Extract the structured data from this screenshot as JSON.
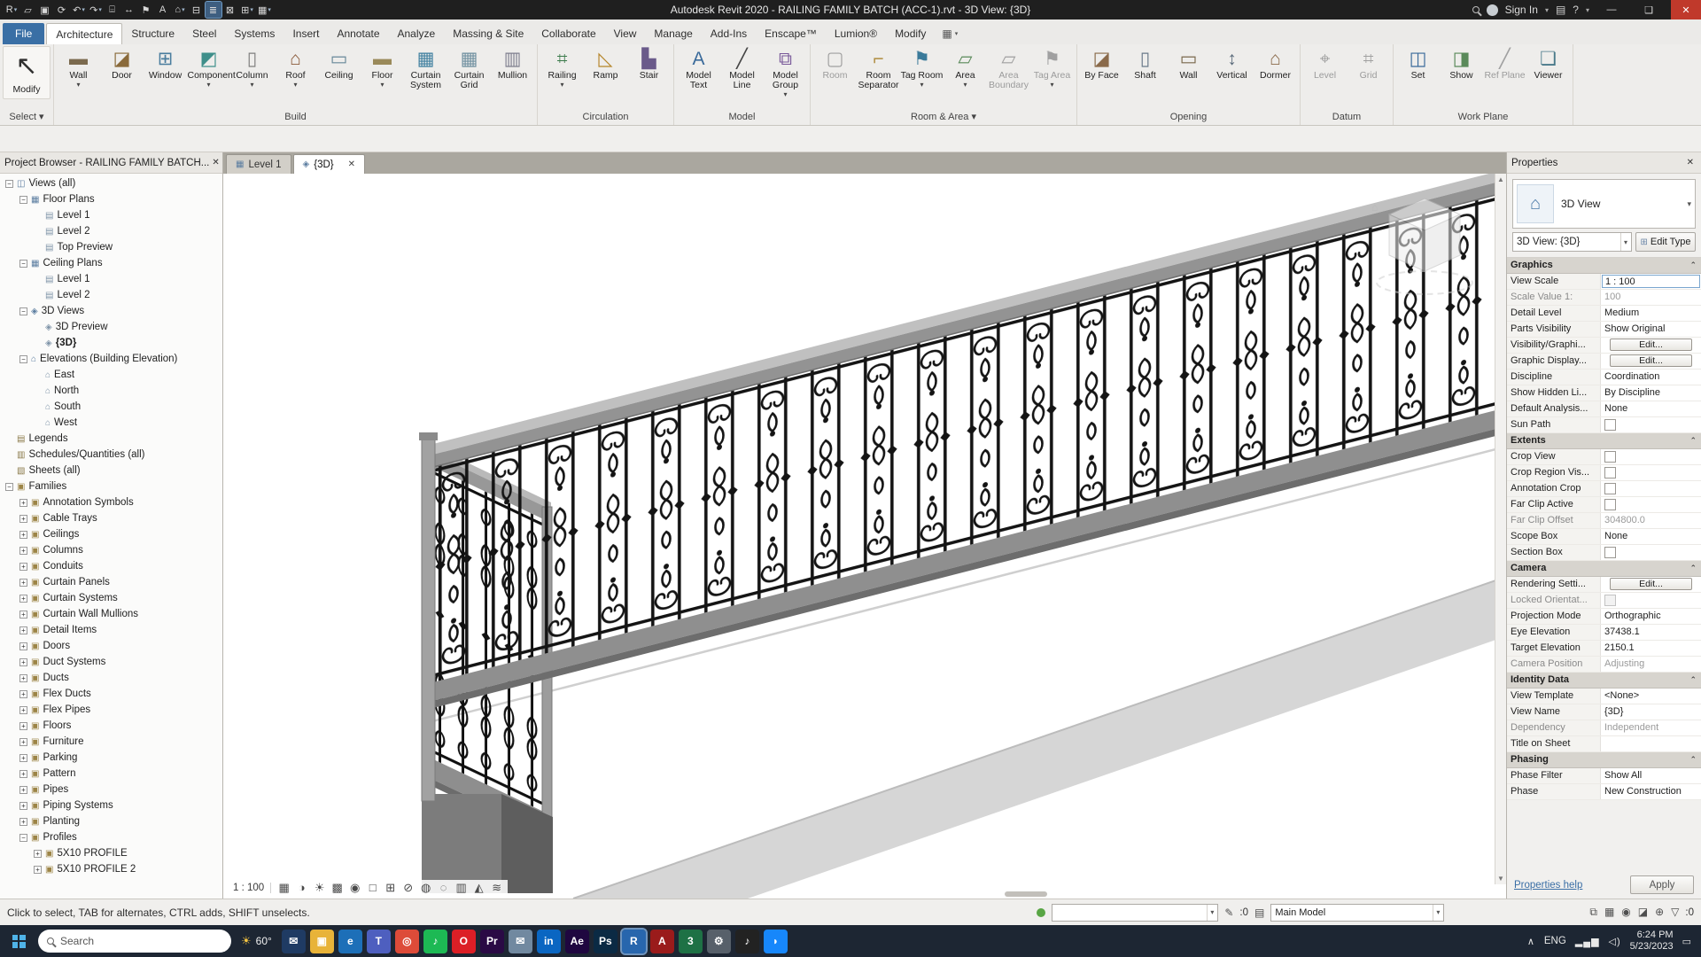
{
  "titlebar": {
    "title": "Autodesk Revit 2020 - RAILING FAMILY BATCH (ACC-1).rvt - 3D View: {3D}",
    "sign_in": "Sign In",
    "qat": [
      {
        "n": "app-menu",
        "g": "R",
        "arrow": "▾"
      },
      {
        "n": "open",
        "g": "▱"
      },
      {
        "n": "save",
        "g": "▣"
      },
      {
        "n": "sync",
        "g": "⟳"
      },
      {
        "n": "undo",
        "g": "↶",
        "arrow": "▾"
      },
      {
        "n": "redo",
        "g": "↷",
        "arrow": "▾"
      },
      {
        "n": "print",
        "g": "⌸"
      },
      {
        "n": "measure",
        "g": "↔"
      },
      {
        "n": "tag",
        "g": "⚑"
      },
      {
        "n": "text",
        "g": "A"
      },
      {
        "n": "default-3d-view",
        "g": "⌂",
        "arrow": "▾"
      },
      {
        "n": "section",
        "g": "⊟"
      },
      {
        "n": "thin-lines",
        "g": "≣",
        "active": true
      },
      {
        "n": "close-hidden-windows",
        "g": "⊠"
      },
      {
        "n": "switch-windows",
        "g": "⊞",
        "arrow": "▾"
      },
      {
        "n": "user-interface",
        "g": "▦",
        "arrow": "▾"
      }
    ]
  },
  "ribbon": {
    "tabs": [
      {
        "label": "File",
        "kind": "file"
      },
      {
        "label": "Architecture",
        "active": true
      },
      {
        "label": "Structure"
      },
      {
        "label": "Steel"
      },
      {
        "label": "Systems"
      },
      {
        "label": "Insert"
      },
      {
        "label": "Annotate"
      },
      {
        "label": "Analyze"
      },
      {
        "label": "Massing & Site"
      },
      {
        "label": "Collaborate"
      },
      {
        "label": "View"
      },
      {
        "label": "Manage"
      },
      {
        "label": "Add-Ins"
      },
      {
        "label": "Enscape™"
      },
      {
        "label": "Lumion®"
      },
      {
        "label": "Modify"
      }
    ],
    "panels": {
      "select": {
        "title": "Select ▾",
        "modify_label": "Modify",
        "modify_glyph": "↖"
      },
      "build": {
        "title": "Build",
        "buttons": [
          {
            "label": "Wall",
            "g": "▬",
            "c": "#7b6a4e",
            "arrow": "▾"
          },
          {
            "label": "Door",
            "g": "◪",
            "c": "#8a6a3a"
          },
          {
            "label": "Window",
            "g": "⊞",
            "c": "#4a7d9e"
          },
          {
            "label": "Component",
            "g": "◩",
            "c": "#3f8f8a",
            "arrow": "▾"
          },
          {
            "label": "Column",
            "g": "▯",
            "c": "#7f7f7f",
            "arrow": "▾"
          },
          {
            "label": "Roof",
            "g": "⌂",
            "c": "#8a5a3a",
            "arrow": "▾"
          },
          {
            "label": "Ceiling",
            "g": "▭",
            "c": "#6a8a9a"
          },
          {
            "label": "Floor",
            "g": "▬",
            "c": "#9a8a5a",
            "arrow": "▾"
          },
          {
            "label": "Curtain System",
            "g": "▦",
            "c": "#3f7f9f"
          },
          {
            "label": "Curtain Grid",
            "g": "▦",
            "c": "#6f8f9f"
          },
          {
            "label": "Mullion",
            "g": "▥",
            "c": "#7f7f8f"
          }
        ]
      },
      "circulation": {
        "title": "Circulation",
        "buttons": [
          {
            "label": "Railing",
            "g": "⌗",
            "c": "#3a7a4a",
            "arrow": "▾"
          },
          {
            "label": "Ramp",
            "g": "◺",
            "c": "#b5862b"
          },
          {
            "label": "Stair",
            "g": "▙",
            "c": "#6a5a8a"
          }
        ]
      },
      "model": {
        "title": "Model",
        "buttons": [
          {
            "label": "Model Text",
            "g": "A",
            "c": "#3a6a9a"
          },
          {
            "label": "Model Line",
            "g": "╱",
            "c": "#444444"
          },
          {
            "label": "Model Group",
            "g": "⧉",
            "c": "#7a5a9a",
            "arrow": "▾"
          }
        ]
      },
      "room_area": {
        "title": "Room & Area ▾",
        "buttons": [
          {
            "label": "Room",
            "g": "▢",
            "c": "#a0a0a0",
            "dis": true
          },
          {
            "label": "Room Separator",
            "g": "⌐",
            "c": "#b08d3f"
          },
          {
            "label": "Tag Room",
            "g": "⚑",
            "c": "#3a7a9a",
            "arrow": "▾"
          },
          {
            "label": "Area",
            "g": "▱",
            "c": "#5a8a5a",
            "arrow": "▾"
          },
          {
            "label": "Area Boundary",
            "g": "▱",
            "c": "#a0a0a0",
            "dis": true
          },
          {
            "label": "Tag Area",
            "g": "⚑",
            "c": "#a0a0a0",
            "arrow": "▾",
            "dis": true
          }
        ]
      },
      "opening": {
        "title": "Opening",
        "buttons": [
          {
            "label": "By Face",
            "g": "◪",
            "c": "#8a6a4a"
          },
          {
            "label": "Shaft",
            "g": "▯",
            "c": "#6a7a8a"
          },
          {
            "label": "Wall",
            "g": "▭",
            "c": "#7b6a4e"
          },
          {
            "label": "Vertical",
            "g": "↕",
            "c": "#5a6a7a"
          },
          {
            "label": "Dormer",
            "g": "⌂",
            "c": "#8a6a4a"
          }
        ]
      },
      "datum": {
        "title": "Datum",
        "buttons": [
          {
            "label": "Level",
            "g": "⌖",
            "c": "#a0a0a0",
            "dis": true
          },
          {
            "label": "Grid",
            "g": "⌗",
            "c": "#a0a0a0",
            "dis": true
          }
        ]
      },
      "work_plane": {
        "title": "Work Plane",
        "buttons": [
          {
            "label": "Set",
            "g": "◫",
            "c": "#3a6a9a"
          },
          {
            "label": "Show",
            "g": "◨",
            "c": "#5a8a5a"
          },
          {
            "label": "Ref Plane",
            "g": "╱",
            "c": "#a0a0a0",
            "dis": true
          },
          {
            "label": "Viewer",
            "g": "❏",
            "c": "#4a7a8a"
          }
        ]
      }
    }
  },
  "browser": {
    "header": "Project Browser - RAILING FAMILY BATCH...",
    "items": [
      {
        "lvl": 0,
        "exp": "−",
        "ic": "◫",
        "icc": "#5b7da0",
        "label": "Views (all)"
      },
      {
        "lvl": 1,
        "exp": "−",
        "ic": "▦",
        "icc": "#5b7da0",
        "label": "Floor Plans"
      },
      {
        "lvl": 2,
        "ic": "▤",
        "icc": "#7f94a8",
        "label": "Level 1"
      },
      {
        "lvl": 2,
        "ic": "▤",
        "icc": "#7f94a8",
        "label": "Level 2"
      },
      {
        "lvl": 2,
        "ic": "▤",
        "icc": "#7f94a8",
        "label": "Top Preview"
      },
      {
        "lvl": 1,
        "exp": "−",
        "ic": "▦",
        "icc": "#5b7da0",
        "label": "Ceiling Plans"
      },
      {
        "lvl": 2,
        "ic": "▤",
        "icc": "#7f94a8",
        "label": "Level 1"
      },
      {
        "lvl": 2,
        "ic": "▤",
        "icc": "#7f94a8",
        "label": "Level 2"
      },
      {
        "lvl": 1,
        "exp": "−",
        "ic": "◈",
        "icc": "#5b7da0",
        "label": "3D Views"
      },
      {
        "lvl": 2,
        "ic": "◈",
        "icc": "#7f94a8",
        "label": "3D Preview"
      },
      {
        "lvl": 2,
        "ic": "◈",
        "icc": "#7f94a8",
        "label": "{3D}",
        "sel": true
      },
      {
        "lvl": 1,
        "exp": "−",
        "ic": "⌂",
        "icc": "#5b7da0",
        "label": "Elevations (Building Elevation)"
      },
      {
        "lvl": 2,
        "ic": "⌂",
        "icc": "#7f94a8",
        "label": "East"
      },
      {
        "lvl": 2,
        "ic": "⌂",
        "icc": "#7f94a8",
        "label": "North"
      },
      {
        "lvl": 2,
        "ic": "⌂",
        "icc": "#7f94a8",
        "label": "South"
      },
      {
        "lvl": 2,
        "ic": "⌂",
        "icc": "#7f94a8",
        "label": "West"
      },
      {
        "lvl": 0,
        "ic": "▤",
        "icc": "#8a7a4a",
        "label": "Legends"
      },
      {
        "lvl": 0,
        "ic": "▥",
        "icc": "#8a7a4a",
        "label": "Schedules/Quantities (all)"
      },
      {
        "lvl": 0,
        "ic": "▧",
        "icc": "#8a7a4a",
        "label": "Sheets (all)"
      },
      {
        "lvl": 0,
        "exp": "−",
        "ic": "▣",
        "icc": "#9c8446",
        "label": "Families"
      },
      {
        "lvl": 1,
        "exp": "+",
        "ic": "▣",
        "icc": "#9c8446",
        "label": "Annotation Symbols"
      },
      {
        "lvl": 1,
        "exp": "+",
        "ic": "▣",
        "icc": "#9c8446",
        "label": "Cable Trays"
      },
      {
        "lvl": 1,
        "exp": "+",
        "ic": "▣",
        "icc": "#9c8446",
        "label": "Ceilings"
      },
      {
        "lvl": 1,
        "exp": "+",
        "ic": "▣",
        "icc": "#9c8446",
        "label": "Columns"
      },
      {
        "lvl": 1,
        "exp": "+",
        "ic": "▣",
        "icc": "#9c8446",
        "label": "Conduits"
      },
      {
        "lvl": 1,
        "exp": "+",
        "ic": "▣",
        "icc": "#9c8446",
        "label": "Curtain Panels"
      },
      {
        "lvl": 1,
        "exp": "+",
        "ic": "▣",
        "icc": "#9c8446",
        "label": "Curtain Systems"
      },
      {
        "lvl": 1,
        "exp": "+",
        "ic": "▣",
        "icc": "#9c8446",
        "label": "Curtain Wall Mullions"
      },
      {
        "lvl": 1,
        "exp": "+",
        "ic": "▣",
        "icc": "#9c8446",
        "label": "Detail Items"
      },
      {
        "lvl": 1,
        "exp": "+",
        "ic": "▣",
        "icc": "#9c8446",
        "label": "Doors"
      },
      {
        "lvl": 1,
        "exp": "+",
        "ic": "▣",
        "icc": "#9c8446",
        "label": "Duct Systems"
      },
      {
        "lvl": 1,
        "exp": "+",
        "ic": "▣",
        "icc": "#9c8446",
        "label": "Ducts"
      },
      {
        "lvl": 1,
        "exp": "+",
        "ic": "▣",
        "icc": "#9c8446",
        "label": "Flex Ducts"
      },
      {
        "lvl": 1,
        "exp": "+",
        "ic": "▣",
        "icc": "#9c8446",
        "label": "Flex Pipes"
      },
      {
        "lvl": 1,
        "exp": "+",
        "ic": "▣",
        "icc": "#9c8446",
        "label": "Floors"
      },
      {
        "lvl": 1,
        "exp": "+",
        "ic": "▣",
        "icc": "#9c8446",
        "label": "Furniture"
      },
      {
        "lvl": 1,
        "exp": "+",
        "ic": "▣",
        "icc": "#9c8446",
        "label": "Parking"
      },
      {
        "lvl": 1,
        "exp": "+",
        "ic": "▣",
        "icc": "#9c8446",
        "label": "Pattern"
      },
      {
        "lvl": 1,
        "exp": "+",
        "ic": "▣",
        "icc": "#9c8446",
        "label": "Pipes"
      },
      {
        "lvl": 1,
        "exp": "+",
        "ic": "▣",
        "icc": "#9c8446",
        "label": "Piping Systems"
      },
      {
        "lvl": 1,
        "exp": "+",
        "ic": "▣",
        "icc": "#9c8446",
        "label": "Planting"
      },
      {
        "lvl": 1,
        "exp": "−",
        "ic": "▣",
        "icc": "#9c8446",
        "label": "Profiles"
      },
      {
        "lvl": 2,
        "exp": "+",
        "ic": "▣",
        "icc": "#9c8446",
        "label": "5X10 PROFILE"
      },
      {
        "lvl": 2,
        "exp": "+",
        "ic": "▣",
        "icc": "#9c8446",
        "label": "5X10 PROFILE 2"
      }
    ]
  },
  "view_tabs": [
    {
      "label": "Level 1",
      "ic": "▦"
    },
    {
      "label": "{3D}",
      "ic": "◈",
      "active": true,
      "close": "✕"
    }
  ],
  "viewbar": {
    "scale": "1 : 100",
    "icons": [
      {
        "n": "detail-level",
        "g": "▦"
      },
      {
        "n": "visual-style",
        "g": "◑"
      },
      {
        "n": "sun-path",
        "g": "☀"
      },
      {
        "n": "shadows",
        "g": "▩"
      },
      {
        "n": "render-dialog",
        "g": "◉"
      },
      {
        "n": "crop-view",
        "g": "□"
      },
      {
        "n": "show-crop-region",
        "g": "⊞"
      },
      {
        "n": "unlocked-view",
        "g": "⊘"
      },
      {
        "n": "temporary-hide-isolate",
        "g": "◍"
      },
      {
        "n": "reveal-hidden-elements",
        "g": "◌"
      },
      {
        "n": "temporary-view-properties",
        "g": "▥"
      },
      {
        "n": "displace-elements",
        "g": "◭"
      },
      {
        "n": "selection-visibility",
        "g": "≋"
      }
    ]
  },
  "properties": {
    "header": "Properties",
    "type_selector": {
      "label": "3D View",
      "icon_glyph": "⌂"
    },
    "view_combo": "3D View: {3D}",
    "edit_type": "Edit Type",
    "rows": [
      {
        "k": "section",
        "label": "Graphics"
      },
      {
        "k": "input",
        "label": "View Scale",
        "value": "1 : 100"
      },
      {
        "k": "text",
        "label": "Scale Value    1:",
        "value": "100",
        "dim": true
      },
      {
        "k": "text",
        "label": "Detail Level",
        "value": "Medium"
      },
      {
        "k": "text",
        "label": "Parts Visibility",
        "value": "Show Original"
      },
      {
        "k": "btn",
        "label": "Visibility/Graphi...",
        "value": "Edit..."
      },
      {
        "k": "btn",
        "label": "Graphic Display...",
        "value": "Edit..."
      },
      {
        "k": "text",
        "label": "Discipline",
        "value": "Coordination"
      },
      {
        "k": "text",
        "label": "Show Hidden Li...",
        "value": "By Discipline"
      },
      {
        "k": "text",
        "label": "Default Analysis...",
        "value": "None"
      },
      {
        "k": "check",
        "label": "Sun Path"
      },
      {
        "k": "section",
        "label": "Extents"
      },
      {
        "k": "check",
        "label": "Crop View"
      },
      {
        "k": "check",
        "label": "Crop Region Vis..."
      },
      {
        "k": "check",
        "label": "Annotation Crop"
      },
      {
        "k": "check",
        "label": "Far Clip Active"
      },
      {
        "k": "text",
        "label": "Far Clip Offset",
        "value": "304800.0",
        "dim": true
      },
      {
        "k": "text",
        "label": "Scope Box",
        "value": "None"
      },
      {
        "k": "check",
        "label": "Section Box"
      },
      {
        "k": "section",
        "label": "Camera"
      },
      {
        "k": "btn",
        "label": "Rendering Setti...",
        "value": "Edit..."
      },
      {
        "k": "check",
        "label": "Locked Orientat...",
        "dim": true
      },
      {
        "k": "text",
        "label": "Projection Mode",
        "value": "Orthographic"
      },
      {
        "k": "text",
        "label": "Eye Elevation",
        "value": "37438.1"
      },
      {
        "k": "text",
        "label": "Target Elevation",
        "value": "2150.1"
      },
      {
        "k": "text",
        "label": "Camera Position",
        "value": "Adjusting",
        "dim": true
      },
      {
        "k": "section",
        "label": "Identity Data"
      },
      {
        "k": "text",
        "label": "View Template",
        "value": "<None>"
      },
      {
        "k": "text",
        "label": "View Name",
        "value": "{3D}"
      },
      {
        "k": "text",
        "label": "Dependency",
        "value": "Independent",
        "dim": true
      },
      {
        "k": "text",
        "label": "Title on Sheet",
        "value": ""
      },
      {
        "k": "section",
        "label": "Phasing"
      },
      {
        "k": "text",
        "label": "Phase Filter",
        "value": "Show All"
      },
      {
        "k": "text",
        "label": "Phase",
        "value": "New Construction"
      }
    ],
    "help": "Properties help",
    "apply": "Apply"
  },
  "statusbar": {
    "message": "Click to select, TAB for alternates, CTRL adds, SHIFT unselects.",
    "workset_value": "",
    "editable_count": ":0",
    "design_option": "Main Model",
    "right_icons": [
      {
        "n": "select-links",
        "g": "⧉"
      },
      {
        "n": "select-underlay",
        "g": "▦"
      },
      {
        "n": "select-pinned",
        "g": "◉"
      },
      {
        "n": "select-by-face",
        "g": "◪"
      },
      {
        "n": "drag-on-selection",
        "g": "⊕"
      },
      {
        "n": "filter",
        "g": "▽"
      }
    ],
    "filter_count": ":0"
  },
  "taskbar": {
    "search_placeholder": "Search",
    "weather": "60°",
    "apps": [
      {
        "n": "mail",
        "g": "✉",
        "bg": "#1f3b63"
      },
      {
        "n": "file-explorer",
        "g": "▣",
        "bg": "#e8b339"
      },
      {
        "n": "edge",
        "g": "e",
        "bg": "#1d6fb8"
      },
      {
        "n": "teams",
        "g": "T",
        "bg": "#4e5fbf"
      },
      {
        "n": "chrome",
        "g": "◎",
        "bg": "#dd4b39"
      },
      {
        "n": "spotify",
        "g": "♪",
        "bg": "#1db954"
      },
      {
        "n": "opera",
        "g": "O",
        "bg": "#dc1f26"
      },
      {
        "n": "premiere-pro",
        "g": "Pr",
        "bg": "#2a0a45"
      },
      {
        "n": "mail-secondary",
        "g": "✉",
        "bg": "#7189a0"
      },
      {
        "n": "linkedin",
        "g": "in",
        "bg": "#0a66c2"
      },
      {
        "n": "after-effects",
        "g": "Ae",
        "bg": "#1f0740"
      },
      {
        "n": "photoshop",
        "g": "Ps",
        "bg": "#0b2a44"
      },
      {
        "n": "revit",
        "g": "R",
        "bg": "#2866ad",
        "active": true
      },
      {
        "n": "illustrator-red",
        "g": "A",
        "bg": "#9a1b1b"
      },
      {
        "n": "3ds-max",
        "g": "3",
        "bg": "#1e7145"
      },
      {
        "n": "settings",
        "g": "⚙",
        "bg": "#57606a"
      },
      {
        "n": "media-player",
        "g": "♪",
        "bg": "#222222"
      },
      {
        "n": "messenger",
        "g": "◗",
        "bg": "#1787fb"
      }
    ],
    "lang": "ENG",
    "time": "6:24 PM",
    "date": "5/23/2023"
  }
}
